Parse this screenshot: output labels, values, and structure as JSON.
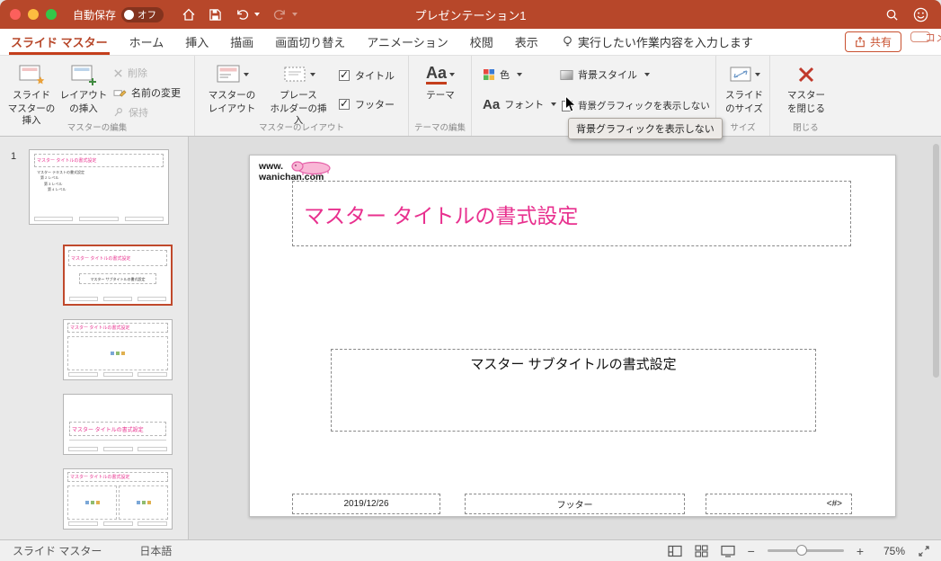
{
  "colors": {
    "titlebar": "#b7472a",
    "accent": "#c43e1c",
    "title_pink": "#e8308e"
  },
  "titlebar": {
    "autosave_label": "自動保存",
    "autosave_state": "オフ",
    "title": "プレゼンテーション1"
  },
  "tabbar": {
    "tabs": [
      "スライド マスター",
      "ホーム",
      "挿入",
      "描画",
      "画面切り替え",
      "アニメーション",
      "校閲",
      "表示"
    ],
    "search_hint": "実行したい作業内容を入力します",
    "share": "共有",
    "comments": "コメント"
  },
  "ribbon": {
    "master_edit": {
      "label": "マスターの編集",
      "insert_master_1": "スライド",
      "insert_master_2": "マスターの挿入",
      "insert_layout_1": "レイアウト",
      "insert_layout_2": "の挿入",
      "delete": "削除",
      "rename": "名前の変更",
      "preserve": "保持"
    },
    "master_layout": {
      "label": "マスターのレイアウト",
      "master_layout_1": "マスターの",
      "master_layout_2": "レイアウト",
      "insert_placeholder_1": "プレース",
      "insert_placeholder_2": "ホルダーの挿入",
      "title_checkbox": "タイトル",
      "footer_checkbox": "フッター"
    },
    "theme_edit": {
      "label": "テーマの編集",
      "theme": "テーマ",
      "theme_glyph": "Aa"
    },
    "background": {
      "colors": "色",
      "fonts": "フォント",
      "font_glyph": "Aa",
      "bg_styles": "背景スタイル",
      "hide_bg": "背景グラフィックを表示しない",
      "tooltip": "背景グラフィックを表示しない"
    },
    "size": {
      "label": "サイズ",
      "slide_size_1": "スライド",
      "slide_size_2": "のサイズ"
    },
    "close": {
      "label": "閉じる",
      "close_master_1": "マスター",
      "close_master_2": "を閉じる"
    }
  },
  "panel": {
    "number": "1",
    "master_title": "マスター タイトルの書式設定",
    "master_text": "マスター テキストの書式設定",
    "level2": "第 2 レベル",
    "level3": "第 3 レベル",
    "level4": "第 4 レベル",
    "subtitle": "マスター サブタイトルの書式設定"
  },
  "slide": {
    "logo_top": "www.",
    "logo_bottom": "wanichan.com",
    "title": "マスター タイトルの書式設定",
    "subtitle": "マスター サブタイトルの書式設定",
    "date": "2019/12/26",
    "footer": "フッター",
    "number": "<#>"
  },
  "statusbar": {
    "view_name": "スライド マスター",
    "language": "日本語",
    "zoom_out": "−",
    "zoom_in": "+",
    "zoom": "75%"
  }
}
